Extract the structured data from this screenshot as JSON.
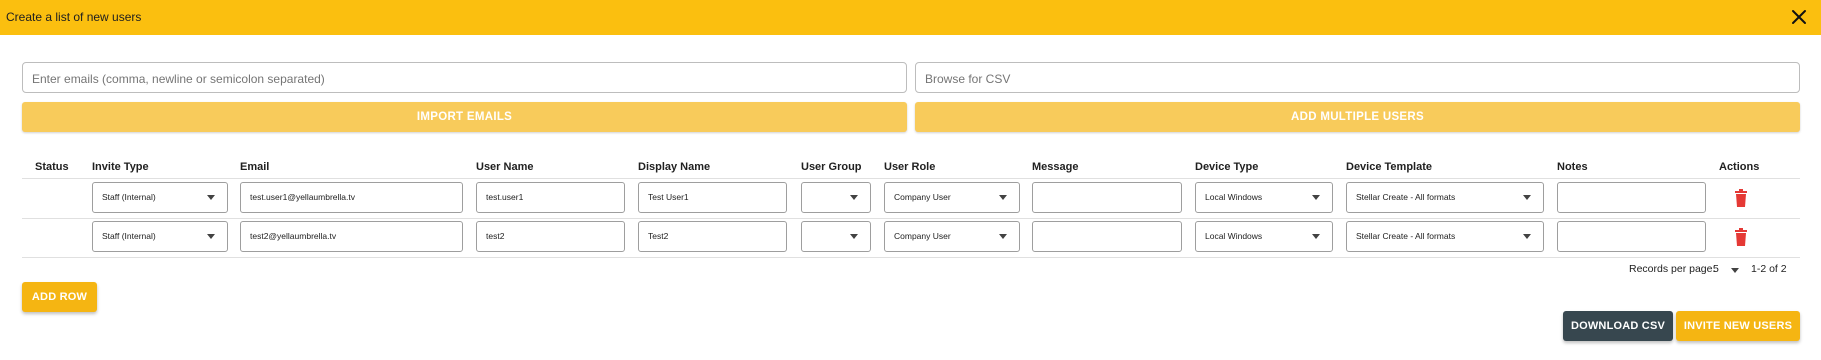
{
  "dialog": {
    "title": "Create a list of new users",
    "close_icon": "close-icon"
  },
  "import": {
    "emails_placeholder": "Enter emails (comma, newline or semicolon separated)",
    "csv_placeholder": "Browse for CSV",
    "import_emails_label": "IMPORT EMAILS",
    "add_multiple_label": "ADD MULTIPLE USERS"
  },
  "table": {
    "headers": {
      "status": "Status",
      "invite_type": "Invite Type",
      "email": "Email",
      "user_name": "User Name",
      "display_name": "Display Name",
      "user_group": "User Group",
      "user_role": "User Role",
      "message": "Message",
      "device_type": "Device Type",
      "device_template": "Device Template",
      "notes": "Notes",
      "actions": "Actions"
    },
    "rows": [
      {
        "status": "",
        "invite_type": "Staff (Internal)",
        "email": "test.user1@yellaumbrella.tv",
        "user_name": "test.user1",
        "display_name": "Test User1",
        "user_group": "",
        "user_role": "Company User",
        "message": "",
        "device_type": "Local Windows",
        "device_template": "Stellar Create - All formats",
        "notes": ""
      },
      {
        "status": "",
        "invite_type": "Staff (Internal)",
        "email": "test2@yellaumbrella.tv",
        "user_name": "test2",
        "display_name": "Test2",
        "user_group": "",
        "user_role": "Company User",
        "message": "",
        "device_type": "Local Windows",
        "device_template": "Stellar Create - All formats",
        "notes": ""
      }
    ],
    "delete_icon": "trash-icon"
  },
  "pagination": {
    "label": "Records per page:",
    "per_page": "5",
    "range": "1-2 of 2"
  },
  "buttons": {
    "add_row": "ADD ROW",
    "download_csv": "DOWNLOAD CSV",
    "invite": "INVITE NEW USERS"
  },
  "colors": {
    "brand_yellow": "#fbbf0f",
    "light_yellow": "#f8cb5b",
    "button_yellow": "#f5b512",
    "dark_button": "#37474f",
    "delete_red": "#e53935"
  }
}
